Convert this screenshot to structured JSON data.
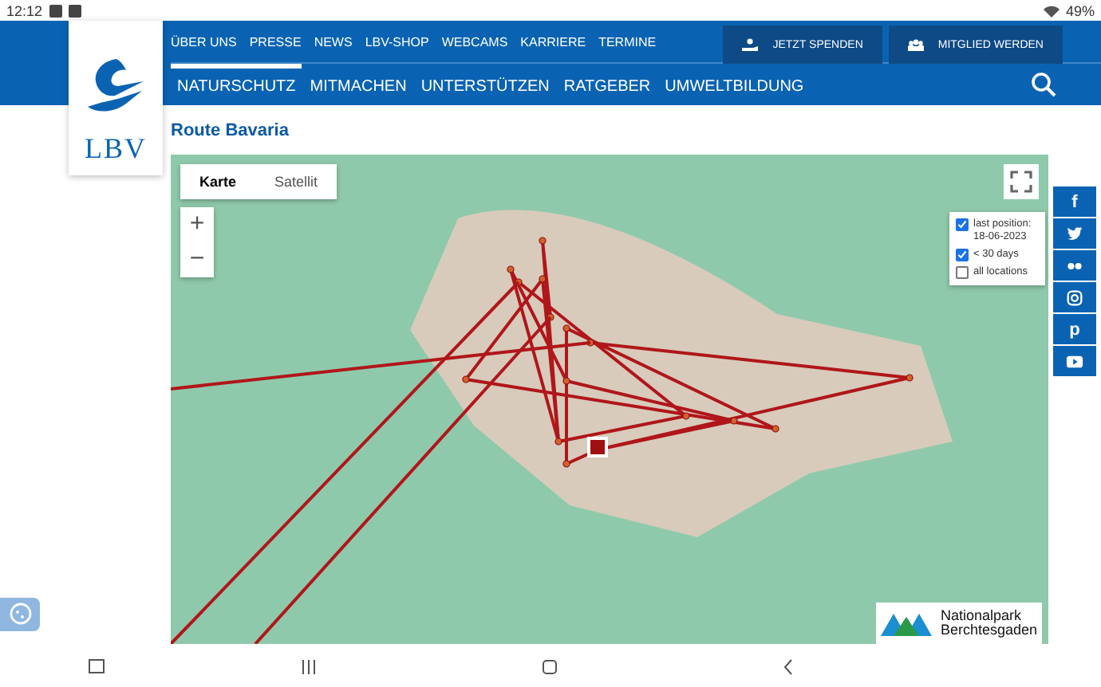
{
  "status_bar": {
    "time": "12:12",
    "battery": "49%"
  },
  "logo": {
    "text": "LBV"
  },
  "top_links": [
    "ÜBER UNS",
    "PRESSE",
    "NEWS",
    "LBV-SHOP",
    "WEBCAMS",
    "KARRIERE",
    "TERMINE"
  ],
  "action_buttons": [
    {
      "kind": "donate",
      "label": "JETZT SPENDEN"
    },
    {
      "kind": "member",
      "label": "MITGLIED WERDEN"
    }
  ],
  "main_nav": [
    {
      "label": "NATURSCHUTZ",
      "selected": true
    },
    {
      "label": "MITMACHEN",
      "selected": false
    },
    {
      "label": "UNTERSTÜTZEN",
      "selected": false
    },
    {
      "label": "RATGEBER",
      "selected": false
    },
    {
      "label": "UMWELTBILDUNG",
      "selected": false
    }
  ],
  "page_title": "Route Bavaria",
  "map": {
    "map_types": [
      {
        "label": "Karte",
        "selected": true
      },
      {
        "label": "Satellit",
        "selected": false
      }
    ],
    "zoom": [
      "+",
      "−"
    ],
    "legend": [
      {
        "label": "last position: 18-06-2023",
        "checked": true
      },
      {
        "label": "< 30 days",
        "checked": true
      },
      {
        "label": "all locations",
        "checked": false
      }
    ],
    "partner_logo": {
      "line1": "Nationalpark",
      "line2": "Berchtesgaden"
    }
  },
  "social": [
    {
      "kind": "facebook",
      "label": "f"
    },
    {
      "kind": "twitter"
    },
    {
      "kind": "flickr"
    },
    {
      "kind": "instagram"
    },
    {
      "kind": "pinterest",
      "label": "p"
    },
    {
      "kind": "youtube"
    }
  ]
}
